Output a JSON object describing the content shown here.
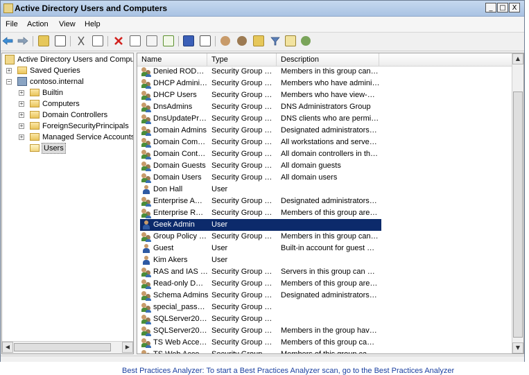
{
  "window": {
    "title": "Active Directory Users and Computers",
    "controls": [
      "_",
      "□",
      "X"
    ]
  },
  "menu": [
    "File",
    "Action",
    "View",
    "Help"
  ],
  "toolbar_icons": [
    "back-arrow-icon",
    "forward-arrow-icon",
    "up-folder-icon",
    "show-hide-tree-icon",
    "cut-icon",
    "copy-icon",
    "delete-icon",
    "properties-icon",
    "refresh-icon",
    "export-list-icon",
    "help-icon",
    "console-tree-icon",
    "new-user-icon",
    "new-group-icon",
    "new-ou-icon",
    "filter-icon",
    "find-icon",
    "add-to-group-icon"
  ],
  "tree": {
    "root": "Active Directory Users and Computers",
    "items": [
      {
        "label": "Saved Queries",
        "level": 1,
        "expander": "+"
      },
      {
        "label": "contoso.internal",
        "level": 1,
        "expander": "−"
      },
      {
        "label": "Builtin",
        "level": 2,
        "expander": "+"
      },
      {
        "label": "Computers",
        "level": 2,
        "expander": "+"
      },
      {
        "label": "Domain Controllers",
        "level": 2,
        "expander": "+"
      },
      {
        "label": "ForeignSecurityPrincipals",
        "level": 2,
        "expander": "+"
      },
      {
        "label": "Managed Service Accounts",
        "level": 2,
        "expander": "+"
      },
      {
        "label": "Users",
        "level": 2,
        "expander": ""
      }
    ]
  },
  "list": {
    "columns": [
      "Name",
      "Type",
      "Description"
    ],
    "rows": [
      {
        "name": "Denied ROD…",
        "type": "Security Group …",
        "desc": "Members in this group can…",
        "kind": "group"
      },
      {
        "name": "DHCP Admini…",
        "type": "Security Group …",
        "desc": "Members who have admini…",
        "kind": "group"
      },
      {
        "name": "DHCP Users",
        "type": "Security Group …",
        "desc": "Members who have view-…",
        "kind": "group"
      },
      {
        "name": "DnsAdmins",
        "type": "Security Group …",
        "desc": "DNS Administrators Group",
        "kind": "group"
      },
      {
        "name": "DnsUpdatePr…",
        "type": "Security Group …",
        "desc": "DNS clients who are permi…",
        "kind": "group"
      },
      {
        "name": "Domain Admins",
        "type": "Security Group …",
        "desc": "Designated administrators…",
        "kind": "group"
      },
      {
        "name": "Domain Com…",
        "type": "Security Group …",
        "desc": "All workstations and serve…",
        "kind": "group"
      },
      {
        "name": "Domain Cont…",
        "type": "Security Group …",
        "desc": "All domain controllers in th…",
        "kind": "group"
      },
      {
        "name": "Domain Guests",
        "type": "Security Group …",
        "desc": "All domain guests",
        "kind": "group"
      },
      {
        "name": "Domain Users",
        "type": "Security Group …",
        "desc": "All domain users",
        "kind": "group"
      },
      {
        "name": "Don Hall",
        "type": "User",
        "desc": "",
        "kind": "user"
      },
      {
        "name": "Enterprise A…",
        "type": "Security Group …",
        "desc": "Designated administrators…",
        "kind": "group"
      },
      {
        "name": "Enterprise R…",
        "type": "Security Group …",
        "desc": "Members of this group are…",
        "kind": "group"
      },
      {
        "name": "Geek Admin",
        "type": "User",
        "desc": "",
        "kind": "user",
        "selected": true
      },
      {
        "name": "Group Policy …",
        "type": "Security Group …",
        "desc": "Members in this group can…",
        "kind": "group"
      },
      {
        "name": "Guest",
        "type": "User",
        "desc": "Built-in account for guest …",
        "kind": "user"
      },
      {
        "name": "Kim Akers",
        "type": "User",
        "desc": "",
        "kind": "user"
      },
      {
        "name": "RAS and IAS …",
        "type": "Security Group …",
        "desc": "Servers in this group can …",
        "kind": "group"
      },
      {
        "name": "Read-only D…",
        "type": "Security Group …",
        "desc": "Members of this group are…",
        "kind": "group"
      },
      {
        "name": "Schema Admins",
        "type": "Security Group …",
        "desc": "Designated administrators…",
        "kind": "group"
      },
      {
        "name": "special_pass…",
        "type": "Security Group …",
        "desc": "",
        "kind": "group"
      },
      {
        "name": "SQLServer20…",
        "type": "Security Group …",
        "desc": "",
        "kind": "group"
      },
      {
        "name": "SQLServer20…",
        "type": "Security Group …",
        "desc": "Members in the group hav…",
        "kind": "group"
      },
      {
        "name": "TS Web Acce…",
        "type": "Security Group …",
        "desc": "Members of this group ca…",
        "kind": "group"
      },
      {
        "name": "TS Web Acce…",
        "type": "Security Group …",
        "desc": "Members of this group ca…",
        "kind": "group"
      }
    ]
  },
  "background_text": "Best Practices Analyzer: To start a Best Practices Analyzer scan, go to the Best Practices Analyzer"
}
